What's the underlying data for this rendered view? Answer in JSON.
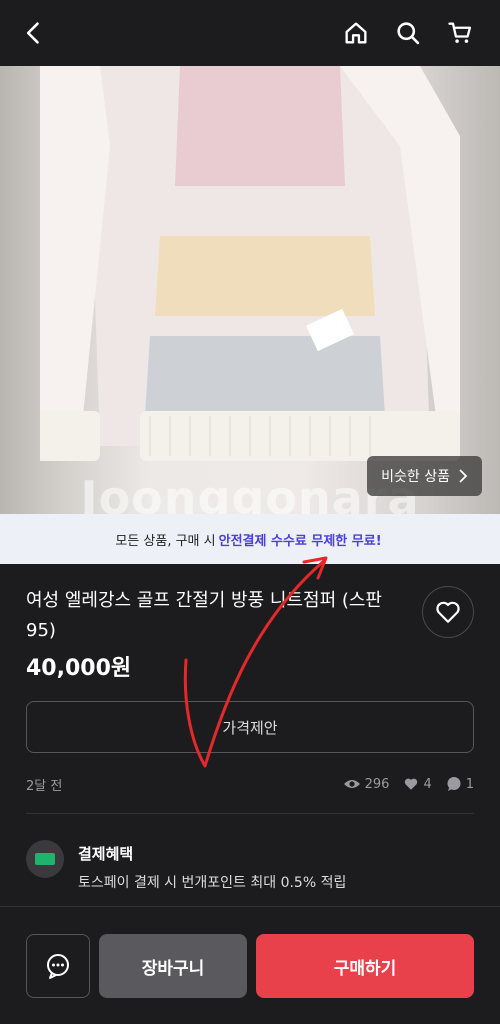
{
  "header": {
    "icons": [
      "back-icon",
      "home-icon",
      "search-icon",
      "cart-icon"
    ]
  },
  "photo": {
    "watermark": "Joonggonara",
    "similar_label": "비슷한 상품"
  },
  "banner": {
    "prefix": "모든 상품, 구매 시",
    "highlight": "안전결제 수수료 무제한 무료!"
  },
  "product": {
    "title": "여성 엘레강스 골프 간절기 방풍 니트점퍼 (스판95)",
    "price": "40,000원",
    "offer_label": "가격제안",
    "posted": "2달 전",
    "views": "296",
    "likes": "4",
    "chats": "1"
  },
  "benefit": {
    "title": "결제혜택",
    "desc": "토스페이 결제 시 번개포인트 최대 0.5% 적립"
  },
  "bottom": {
    "cart_label": "장바구니",
    "buy_label": "구매하기"
  },
  "colors": {
    "accent": "#e8414b",
    "banner_highlight": "#4a3fd6",
    "annotation": "#e5282a"
  }
}
